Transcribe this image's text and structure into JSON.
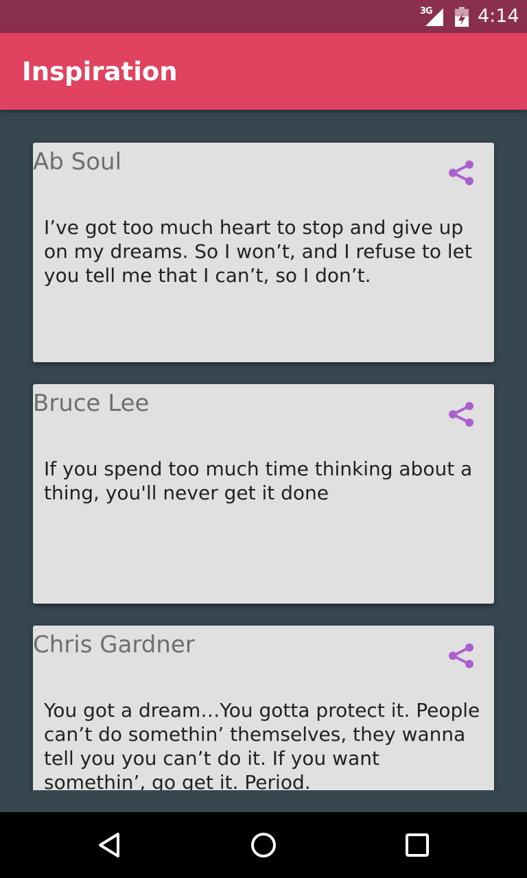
{
  "status_bar": {
    "network_label": "3G",
    "time": "4:14",
    "icons": [
      "signal-icon",
      "battery-icon"
    ]
  },
  "app_bar": {
    "title": "Inspiration",
    "color": "#e0425f"
  },
  "cards": [
    {
      "author": "Ab Soul",
      "quote": "I’ve got too much heart to stop and give up on my dreams. So I won’t, and I refuse to let you tell me that I can’t, so I don’t.",
      "icon": "share-icon"
    },
    {
      "author": "Bruce Lee",
      "quote": "If you spend too much time thinking about a thing, you'll never get it done",
      "icon": "share-icon"
    },
    {
      "author": "Chris Gardner",
      "quote": "You got a dream…You gotta protect it. People can’t do somethin’ themselves, they wanna tell you you can’t do it. If you want somethin’, go get it. Period.",
      "icon": "share-icon"
    }
  ],
  "colors": {
    "status_bar": "#8b2f4f",
    "background": "#37474f",
    "card": "#e0e0e0",
    "share_icon": "#ab5fcf"
  },
  "nav_bar": {
    "icons": [
      "back-icon",
      "home-icon",
      "recents-icon"
    ]
  }
}
